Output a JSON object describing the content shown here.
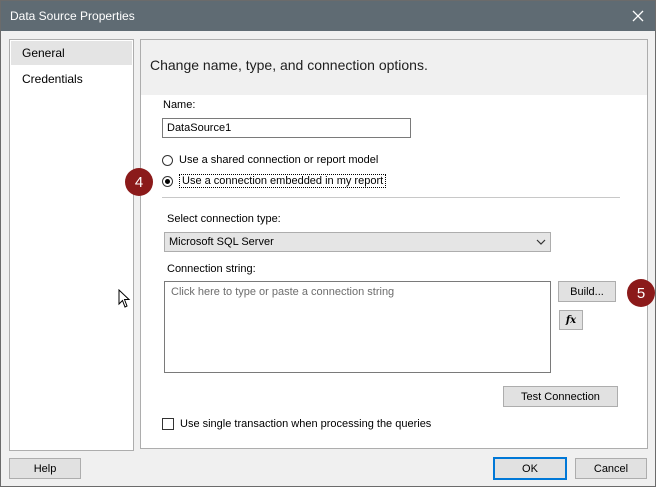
{
  "window": {
    "title": "Data Source Properties"
  },
  "sidebar": {
    "items": [
      {
        "label": "General",
        "active": true
      },
      {
        "label": "Credentials",
        "active": false
      }
    ]
  },
  "main": {
    "header": "Change name, type, and connection options.",
    "name_label": "Name:",
    "name_value": "DataSource1",
    "radio_shared": "Use a shared connection or report model",
    "radio_embedded": "Use a connection embedded in my report",
    "selected_radio": "embedded",
    "connection_type_label": "Select connection type:",
    "connection_type_value": "Microsoft SQL Server",
    "connection_string_label": "Connection string:",
    "connection_string_placeholder": "Click here to type or paste a connection string",
    "connection_string_value": "",
    "build_button": "Build...",
    "fx_button": "fx",
    "test_connection_button": "Test Connection",
    "single_transaction_label": "Use single transaction when processing the queries",
    "single_transaction_checked": false
  },
  "footer": {
    "help_button": "Help",
    "ok_button": "OK",
    "cancel_button": "Cancel"
  },
  "annotations": {
    "step_4": "4",
    "step_5": "5",
    "color": "#8b1a1a"
  },
  "colors": {
    "titlebar": "#5f6b73",
    "default_button_border": "#0078d7"
  }
}
